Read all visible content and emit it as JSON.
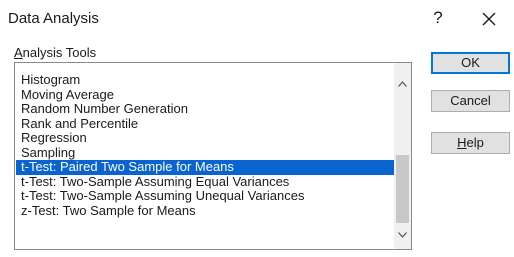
{
  "dialog": {
    "title": "Data Analysis",
    "help_glyph": "?",
    "close_glyph": "close"
  },
  "analysis_tools": {
    "label_mnemonic": "A",
    "label_rest": "nalysis Tools",
    "items": [
      "Histogram",
      "Moving Average",
      "Random Number Generation",
      "Rank and Percentile",
      "Regression",
      "Sampling",
      "t-Test: Paired Two Sample for Means",
      "t-Test: Two-Sample Assuming Equal Variances",
      "t-Test: Two-Sample Assuming Unequal Variances",
      "z-Test: Two Sample for Means"
    ],
    "selected_item": "t-Test: Paired Two Sample for Means"
  },
  "buttons": {
    "ok": "OK",
    "cancel": "Cancel",
    "help_mnemonic": "H",
    "help_rest": "elp"
  },
  "colors": {
    "selection": "#0a64d0",
    "default_button_border": "#0078d7"
  }
}
